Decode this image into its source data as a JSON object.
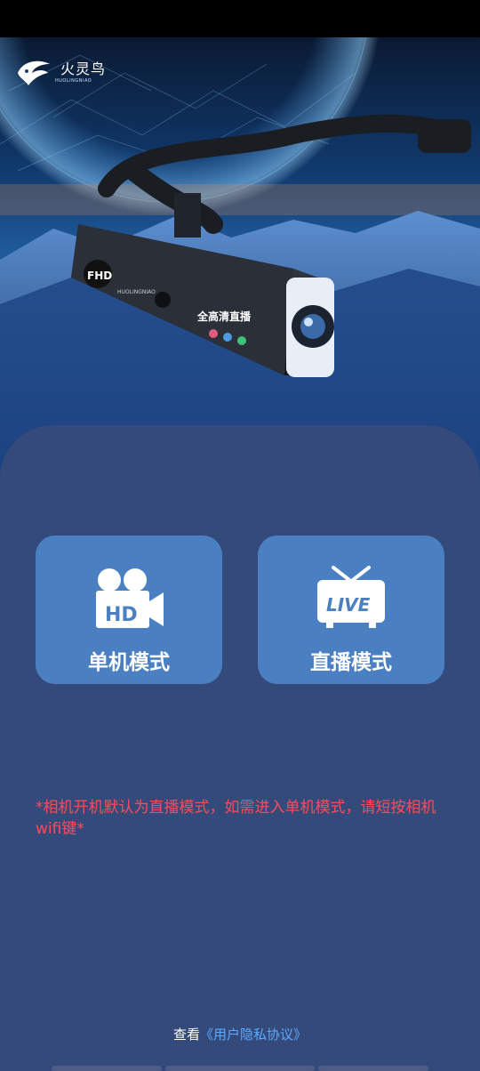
{
  "brand": {
    "name": "火灵鸟",
    "subtitle": "HUOLINGNIAO"
  },
  "product": {
    "badge": "FHD",
    "brand_print": "HUOLINGNIAO",
    "feature_print": "全高清直播"
  },
  "modes": [
    {
      "label": "单机模式",
      "icon": "hd-video-camera-icon",
      "icon_text": "HD"
    },
    {
      "label": "直播模式",
      "icon": "live-tv-icon",
      "icon_text": "LIVE"
    }
  ],
  "notice": "*相机开机默认为直播模式，如需进入单机模式，请短按相机wifi键*",
  "privacy": {
    "prefix": "查看",
    "link": "《用户隐私协议》"
  },
  "colors": {
    "panel": "#344a7a",
    "card": "#4a7fc1",
    "notice": "#ff4a5a",
    "link": "#5aa9ff"
  }
}
